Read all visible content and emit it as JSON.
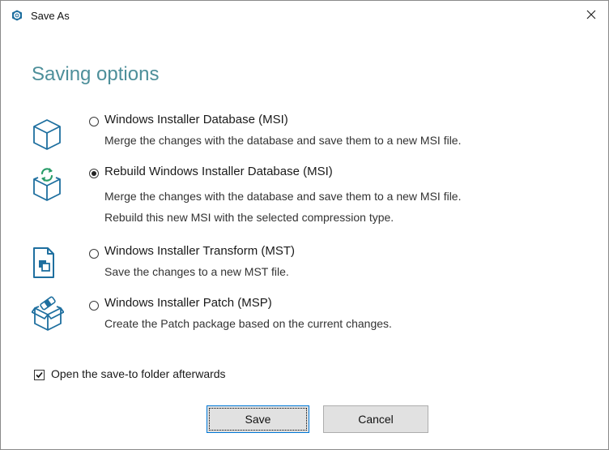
{
  "window": {
    "title": "Save As"
  },
  "heading": "Saving options",
  "options": [
    {
      "label": "Windows Installer Database (MSI)",
      "desc": [
        "Merge the changes with the database and save them to a new MSI file."
      ],
      "selected": false
    },
    {
      "label": "Rebuild Windows Installer Database (MSI)",
      "desc": [
        "Merge the changes with the database and save them to a new MSI file.",
        "Rebuild this new MSI with the selected compression type."
      ],
      "selected": true
    },
    {
      "label": "Windows Installer Transform (MST)",
      "desc": [
        "Save the changes to a new MST file."
      ],
      "selected": false
    },
    {
      "label": "Windows Installer Patch (MSP)",
      "desc": [
        "Create the Patch package based on the current changes."
      ],
      "selected": false
    }
  ],
  "open_folder": {
    "label": "Open the save-to folder afterwards",
    "checked": true
  },
  "buttons": {
    "save": "Save",
    "cancel": "Cancel"
  },
  "colors": {
    "accent": "#4d8f9a",
    "icon_blue": "#1e6f9f",
    "button_focus": "#0078d7"
  }
}
